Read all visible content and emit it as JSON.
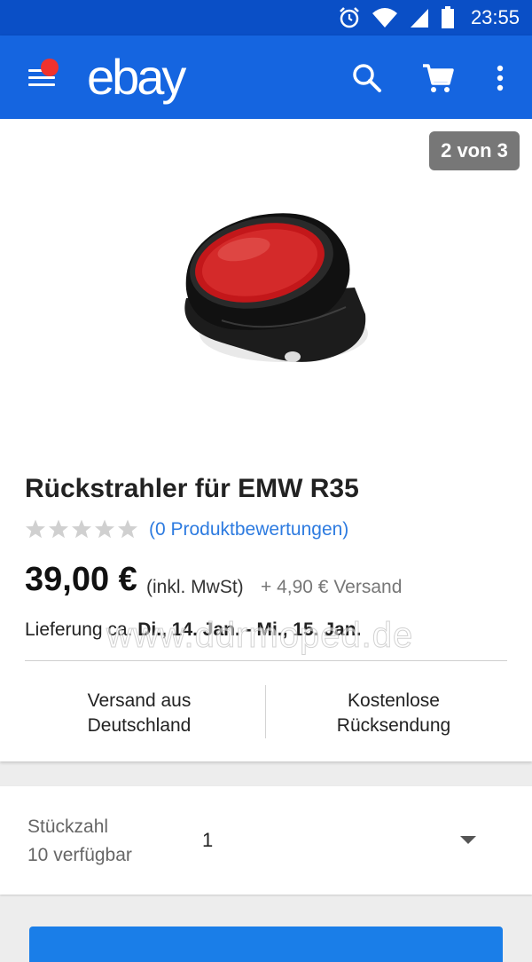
{
  "status_bar": {
    "time": "23:55",
    "icons": [
      "alarm-icon",
      "wifi-icon",
      "signal-icon",
      "battery-icon"
    ]
  },
  "app_bar": {
    "logo": "ebay",
    "icons": [
      "menu-icon",
      "search-icon",
      "cart-icon",
      "more-vert-icon"
    ],
    "notification_dot_color": "#f0322d",
    "background": "#1565e0"
  },
  "gallery": {
    "counter": "2 von 3"
  },
  "product": {
    "title": "Rückstrahler für EMW R35",
    "rating": 0,
    "rating_max": 5,
    "reviews_link": "(0 Produktbewertungen)",
    "price": "39,00 €",
    "vat_note": "(inkl. MwSt)",
    "shipping": "+ 4,90 € Versand",
    "delivery_prefix": "Lieferung ca.",
    "delivery_dates": "Di., 14. Jan. - Mi., 15. Jan.",
    "watermark": "www.ddrmoped.de"
  },
  "features": {
    "left": [
      "Versand aus",
      "Deutschland"
    ],
    "right": [
      "Kostenlose",
      "Rücksendung"
    ]
  },
  "quantity": {
    "label": "Stückzahl",
    "available": "10 verfügbar",
    "value": "1"
  },
  "colors": {
    "link": "#2d7be0",
    "primary_button": "#1a7ee8",
    "status_bar": "#0a4fc6"
  }
}
